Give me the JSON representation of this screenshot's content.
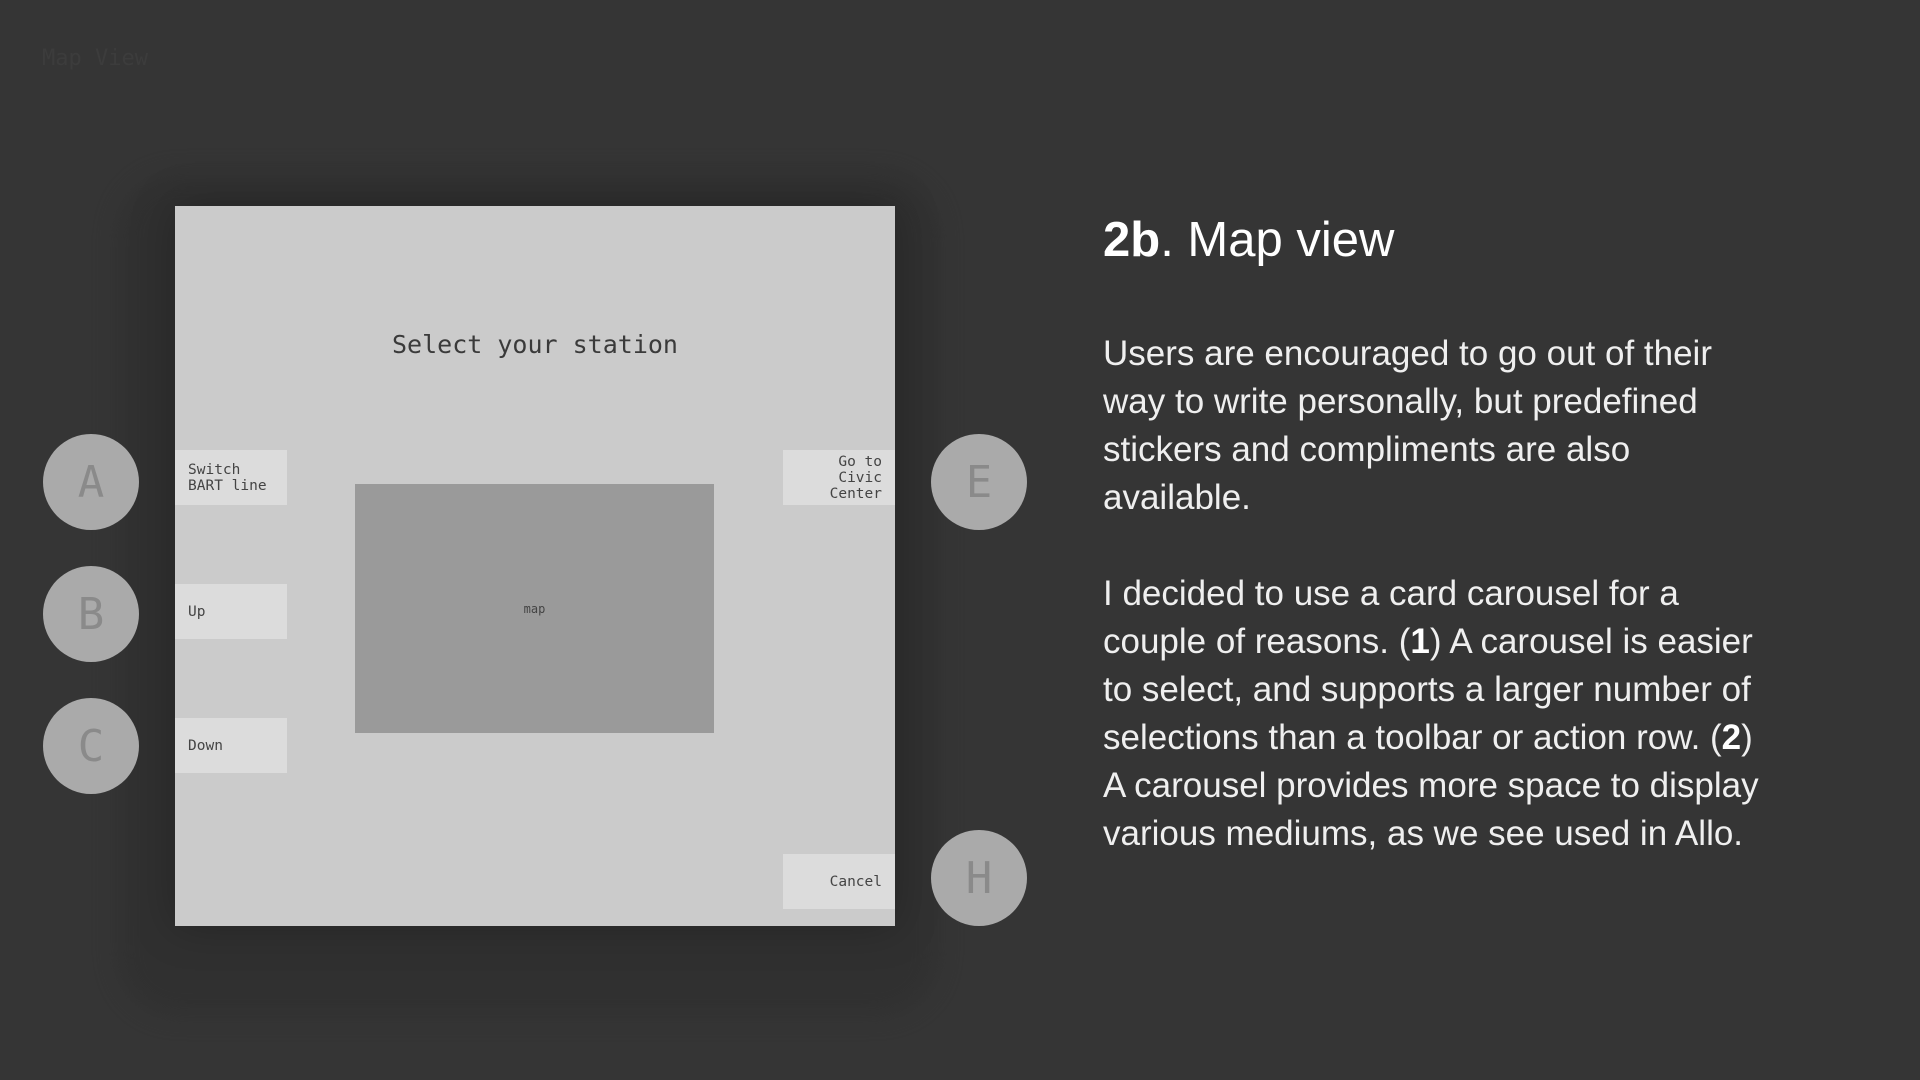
{
  "page_label": "Map View",
  "screen": {
    "title": "Select your station",
    "buttons": {
      "switch_line": "Switch\nBART line",
      "up": "Up",
      "down": "Down",
      "go_to": "Go to\nCivic\nCenter",
      "cancel": "Cancel"
    },
    "map_label": "map"
  },
  "hardware_buttons": {
    "a": "A",
    "b": "B",
    "c": "C",
    "e": "E",
    "h": "H"
  },
  "heading": {
    "number": "2b",
    "title": ". Map view"
  },
  "paragraph1": "Users are encouraged to go out of their way to write personally, but predefined stickers and compliments are also available.",
  "paragraph2": {
    "part1": "I decided to use a card carousel for a couple of reasons. (",
    "num1": "1",
    "part2": ") A carousel is easier to select, and supports a larger number of selections than a toolbar or action row. (",
    "num2": "2",
    "part3": ") A carousel provides more space to display various mediums, as we see used in Allo."
  },
  "colors": {
    "background": "#353535",
    "screen": "#cbcbcb",
    "map": "#9a9a9a",
    "hardware_button": "#aaaaaa"
  }
}
